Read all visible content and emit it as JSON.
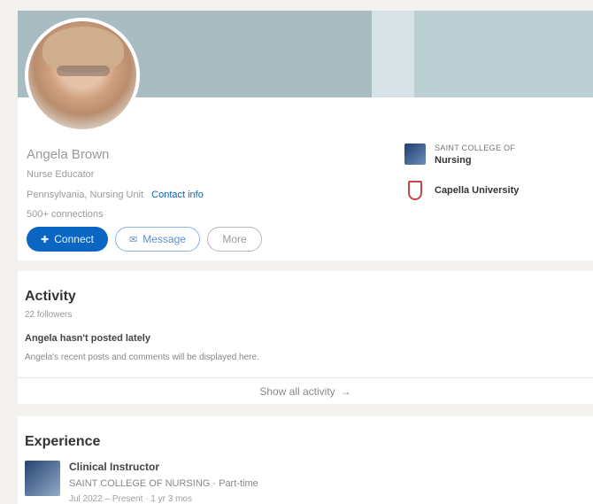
{
  "profile": {
    "name": "Angela Brown",
    "headline": "Nurse Educator",
    "location": "Pennsylvania, Nursing Unit",
    "contact_info": "Contact info",
    "connections": "500+ connections"
  },
  "actions": {
    "connect": "Connect",
    "message": "Message",
    "more": "More"
  },
  "organizations": [
    {
      "subtitle": "SAINT COLLEGE OF",
      "name": "Nursing"
    },
    {
      "name": "Capella University"
    }
  ],
  "activity": {
    "title": "Activity",
    "followers": "22 followers",
    "post_title": "Angela hasn't posted lately",
    "post_subtitle": "Angela's recent posts and comments will be displayed here.",
    "show_all": "Show all activity"
  },
  "experience": {
    "title": "Experience",
    "items": [
      {
        "role": "Clinical Instructor",
        "org": "SAINT COLLEGE OF NURSING · Part-time",
        "dates": "Jul 2022 – Present · 1 yr 3 mos"
      }
    ]
  },
  "colors": {
    "accent": "#0a66c2",
    "background": "#f3f2ef"
  }
}
